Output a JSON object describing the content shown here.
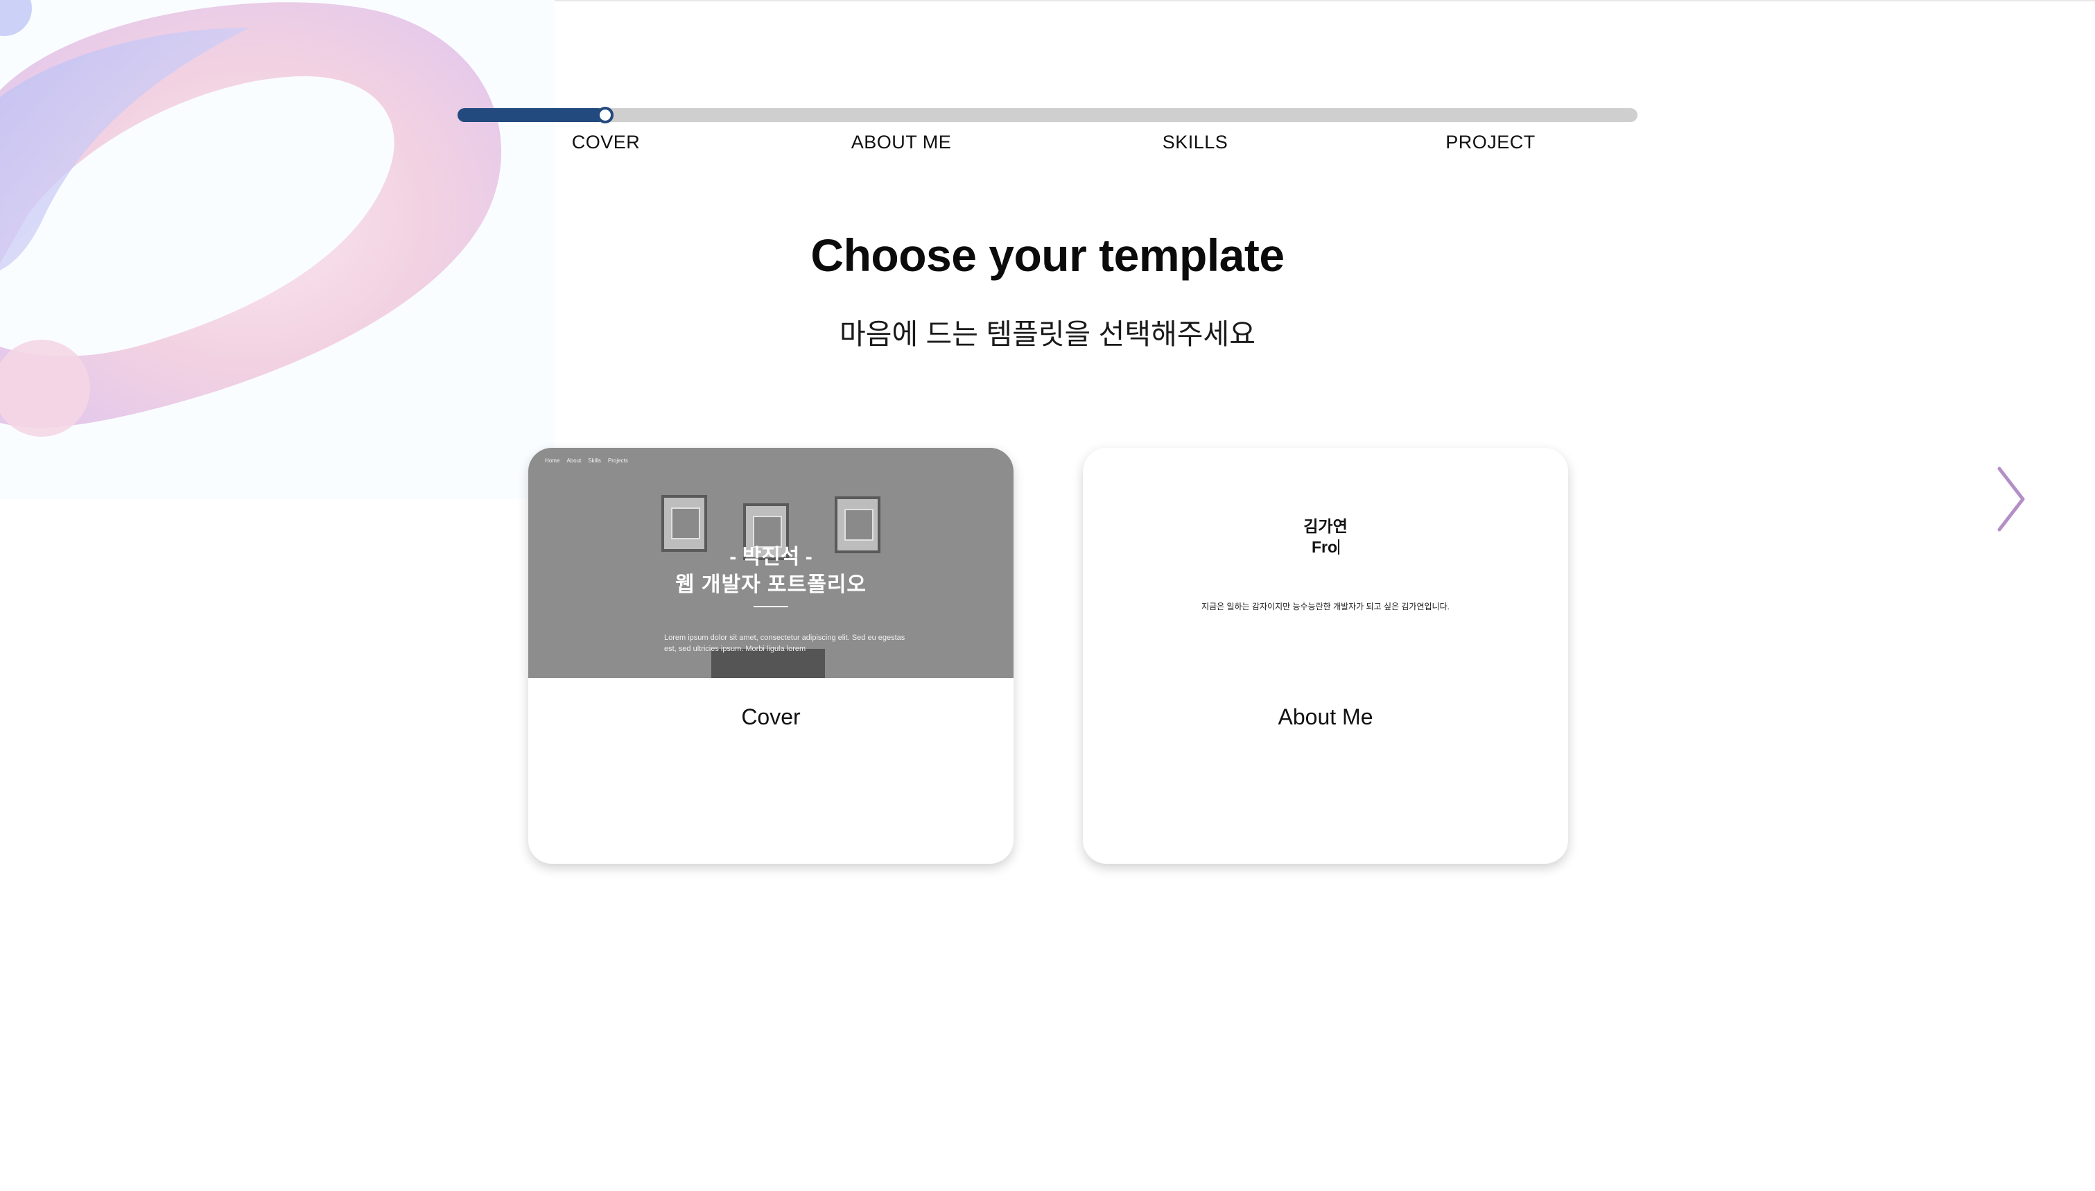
{
  "colors": {
    "progress_fill": "#234a7e",
    "progress_track": "#cfcfcf",
    "arrow": "#b48fc6"
  },
  "progress": {
    "value": 0.125,
    "steps": [
      "COVER",
      "ABOUT ME",
      "SKILLS",
      "PROJECT"
    ]
  },
  "header": {
    "title": "Choose your template",
    "subtitle": "마음에 드는 템플릿을 선택해주세요"
  },
  "cards": [
    {
      "label": "Cover",
      "preview": {
        "nav": [
          "Home",
          "About",
          "Skills",
          "Projects"
        ],
        "name": "- 박진석 -",
        "heading": "웹 개발자 포트폴리오",
        "body": "Lorem ipsum dolor sit amet, consectetur adipiscing elit. Sed eu egestas est, sed ultricies ipsum. Morbi ligula lorem"
      }
    },
    {
      "label": "About Me",
      "preview": {
        "name": "김가연",
        "typed": "Fro",
        "body": "지금은 일하는 감자이지만 능수능란한 개발자가 되고 싶은 김가연입니다."
      }
    }
  ],
  "icons": {
    "next": "chevron-right-icon"
  }
}
